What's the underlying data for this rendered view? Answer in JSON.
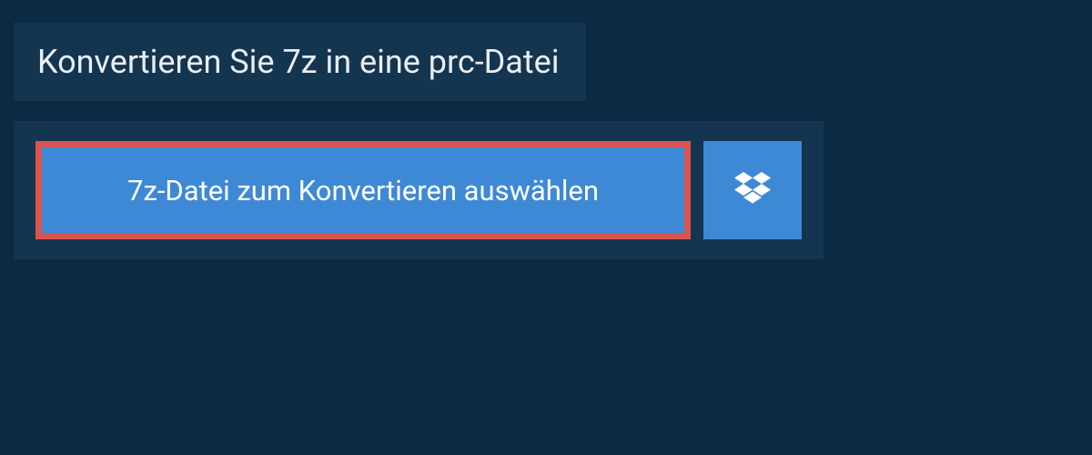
{
  "header": {
    "title": "Konvertieren Sie 7z in eine prc-Datei"
  },
  "actions": {
    "select_file_label": "7z-Datei zum Konvertieren auswählen"
  },
  "colors": {
    "background": "#0c2a42",
    "panel": "#14354f",
    "button": "#3e89d6",
    "highlight_border": "#d9544f",
    "text_light": "#e8eef3"
  },
  "icons": {
    "dropbox": "dropbox-icon"
  }
}
